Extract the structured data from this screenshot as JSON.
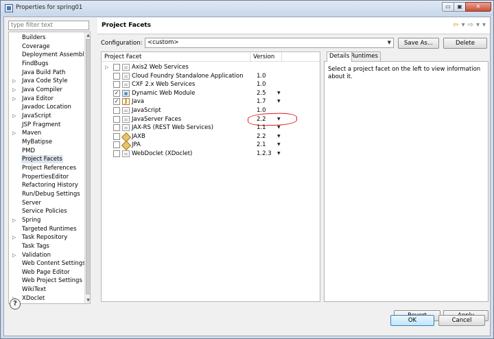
{
  "window": {
    "title": "Properties for spring01",
    "close_label": "✕",
    "min_label": "▭",
    "max_label": "▣"
  },
  "filter": {
    "placeholder": "type filter text"
  },
  "nav": {
    "items": [
      {
        "label": "Builders",
        "expandable": false
      },
      {
        "label": "Coverage",
        "expandable": false
      },
      {
        "label": "Deployment Assembly",
        "expandable": false
      },
      {
        "label": "FindBugs",
        "expandable": false
      },
      {
        "label": "Java Build Path",
        "expandable": false
      },
      {
        "label": "Java Code Style",
        "expandable": true
      },
      {
        "label": "Java Compiler",
        "expandable": true
      },
      {
        "label": "Java Editor",
        "expandable": true
      },
      {
        "label": "Javadoc Location",
        "expandable": false
      },
      {
        "label": "JavaScript",
        "expandable": true
      },
      {
        "label": "JSP Fragment",
        "expandable": false
      },
      {
        "label": "Maven",
        "expandable": true
      },
      {
        "label": "MyBatipse",
        "expandable": false
      },
      {
        "label": "PMD",
        "expandable": false
      },
      {
        "label": "Project Facets",
        "expandable": false,
        "selected": true
      },
      {
        "label": "Project References",
        "expandable": false
      },
      {
        "label": "PropertiesEditor",
        "expandable": false
      },
      {
        "label": "Refactoring History",
        "expandable": false
      },
      {
        "label": "Run/Debug Settings",
        "expandable": false
      },
      {
        "label": "Server",
        "expandable": false
      },
      {
        "label": "Service Policies",
        "expandable": false
      },
      {
        "label": "Spring",
        "expandable": true
      },
      {
        "label": "Targeted Runtimes",
        "expandable": false
      },
      {
        "label": "Task Repository",
        "expandable": true
      },
      {
        "label": "Task Tags",
        "expandable": false
      },
      {
        "label": "Validation",
        "expandable": true
      },
      {
        "label": "Web Content Settings",
        "expandable": false
      },
      {
        "label": "Web Page Editor",
        "expandable": false
      },
      {
        "label": "Web Project Settings",
        "expandable": false
      },
      {
        "label": "WikiText",
        "expandable": false
      },
      {
        "label": "XDoclet",
        "expandable": true
      }
    ]
  },
  "page": {
    "title": "Project Facets",
    "config_label": "Configuration:",
    "config_value": "<custom>",
    "save_as_label": "Save As...",
    "delete_label": "Delete",
    "col_facet": "Project Facet",
    "col_version": "Version",
    "facets": [
      {
        "name": "Axis2 Web Services",
        "version": "",
        "checked": false,
        "expander": true,
        "icon": "doc-icon",
        "dropdown": false
      },
      {
        "name": "Cloud Foundry Standalone Application",
        "version": "1.0",
        "checked": false,
        "expander": false,
        "icon": "doc-icon",
        "dropdown": false
      },
      {
        "name": "CXF 2.x Web Services",
        "version": "1.0",
        "checked": false,
        "expander": false,
        "icon": "doc-icon",
        "dropdown": false
      },
      {
        "name": "Dynamic Web Module",
        "version": "2.5",
        "checked": true,
        "expander": false,
        "icon": "web-module-icon",
        "dropdown": true
      },
      {
        "name": "Java",
        "version": "1.7",
        "checked": true,
        "expander": false,
        "icon": "java-icon",
        "dropdown": true
      },
      {
        "name": "JavaScript",
        "version": "1.0",
        "checked": false,
        "expander": false,
        "icon": "doc-icon",
        "dropdown": false
      },
      {
        "name": "JavaServer Faces",
        "version": "2.2",
        "checked": false,
        "expander": false,
        "icon": "doc-icon",
        "dropdown": true
      },
      {
        "name": "JAX-RS (REST Web Services)",
        "version": "1.1",
        "checked": false,
        "expander": false,
        "icon": "doc-icon",
        "dropdown": true
      },
      {
        "name": "JAXB",
        "version": "2.2",
        "checked": false,
        "expander": false,
        "icon": "jar-icon",
        "dropdown": true
      },
      {
        "name": "JPA",
        "version": "2.1",
        "checked": false,
        "expander": false,
        "icon": "jar-icon",
        "dropdown": true
      },
      {
        "name": "WebDoclet (XDoclet)",
        "version": "1.2.3",
        "checked": false,
        "expander": false,
        "icon": "doc-icon",
        "dropdown": true
      }
    ],
    "tabs": {
      "details": "Details",
      "runtimes": "Runtimes"
    },
    "details_text": "Select a project facet on the left to view information about it.",
    "revert_label": "Revert",
    "apply_label": "Apply"
  },
  "footer": {
    "help_label": "?",
    "ok_label": "OK",
    "cancel_label": "Cancel"
  },
  "colors": {
    "highlight_circle": "#e01818",
    "ok_button": "#bee6fd"
  }
}
